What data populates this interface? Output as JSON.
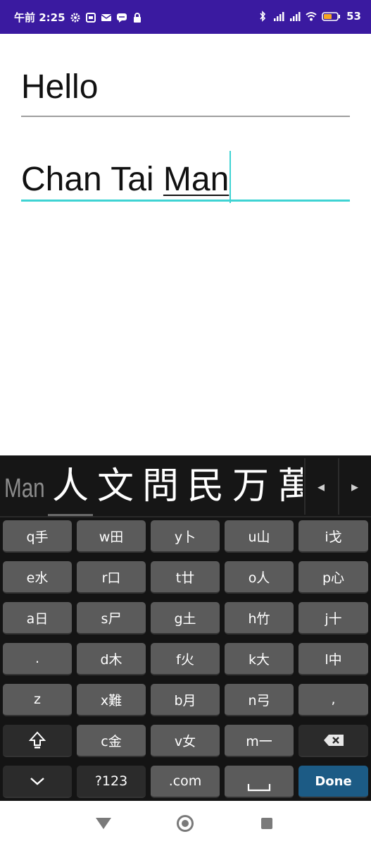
{
  "status_bar": {
    "time": "午前 2:25",
    "battery": "53",
    "notification_icons": [
      "settings-icon",
      "gallery-icon",
      "mail-icon",
      "message-icon",
      "lock-icon"
    ],
    "system_icons": [
      "bluetooth-icon",
      "signal-icon",
      "signal-icon",
      "wifi-icon",
      "battery-icon"
    ]
  },
  "fields": {
    "first": "Hello",
    "second_prefix": "Chan Tai ",
    "second_composing": "Man"
  },
  "keyboard": {
    "composing_text": "Man",
    "candidates": [
      "人",
      "文",
      "問",
      "民",
      "万",
      "萬"
    ],
    "prev_arrow": "◂",
    "next_arrow": "▸",
    "rows": [
      [
        "q手",
        "w田",
        "y卜",
        "u山",
        "i戈"
      ],
      [
        "e水",
        "r口",
        "t廿",
        "o人",
        "p心"
      ],
      [
        "a日",
        "s尸",
        "g土",
        "h竹",
        "j十"
      ],
      [
        ".",
        "d木",
        "f火",
        "k大",
        "l中"
      ],
      [
        "z",
        "x難",
        "b月",
        "n弓",
        ","
      ],
      [
        "shift",
        "c金",
        "v女",
        "m一",
        "delete"
      ],
      [
        "hide",
        "?123",
        ".com",
        "space",
        "Done"
      ]
    ]
  },
  "colors": {
    "status_bar": "#3a1aa0",
    "active_underline": "#3fd3d3",
    "key": "#5b5b5b",
    "done_key": "#1c5b85"
  }
}
